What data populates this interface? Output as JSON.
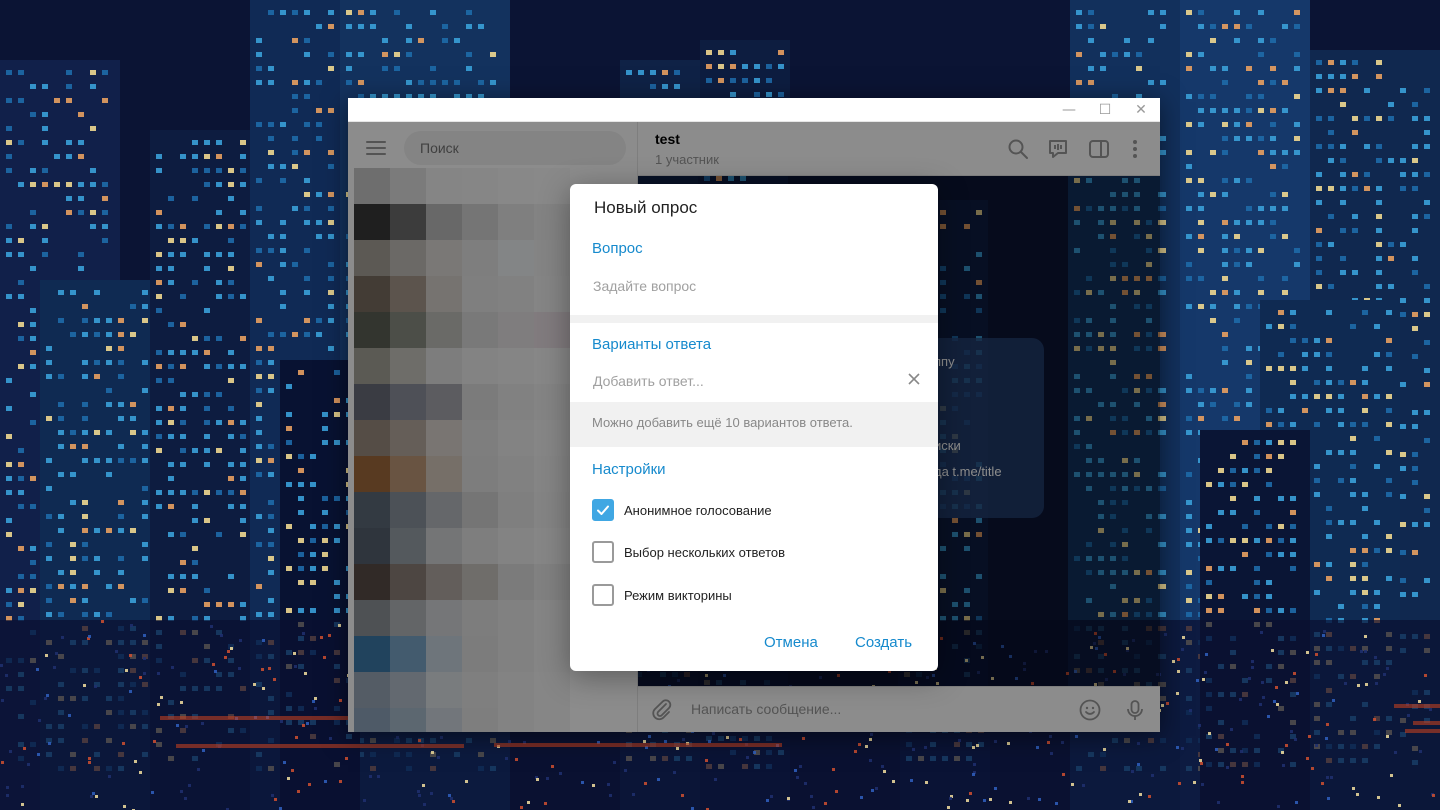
{
  "window": {
    "controls": {
      "minimize": "—",
      "maximize": "☐",
      "close": "✕"
    }
  },
  "sidebar": {
    "search_placeholder": "Поиск"
  },
  "chat": {
    "title": "test",
    "subtitle": "1 участник",
    "composer_placeholder": "Написать сообщение...",
    "background_bubble_fragments": [
      "ппу",
      "иски",
      "да t.me/title"
    ]
  },
  "poll_dialog": {
    "title": "Новый опрос",
    "question_label": "Вопрос",
    "question_placeholder": "Задайте вопрос",
    "answers_label": "Варианты ответа",
    "answer_placeholder": "Добавить ответ...",
    "answers_hint": "Можно добавить ещё 10 вариантов ответа.",
    "settings_label": "Настройки",
    "options": [
      {
        "label": "Анонимное голосование",
        "checked": true
      },
      {
        "label": "Выбор нескольких ответов",
        "checked": false
      },
      {
        "label": "Режим викторины",
        "checked": false
      }
    ],
    "cancel_label": "Отмена",
    "create_label": "Создать"
  },
  "colors": {
    "accent": "#168acd",
    "checkbox_on": "#40a7e3"
  }
}
